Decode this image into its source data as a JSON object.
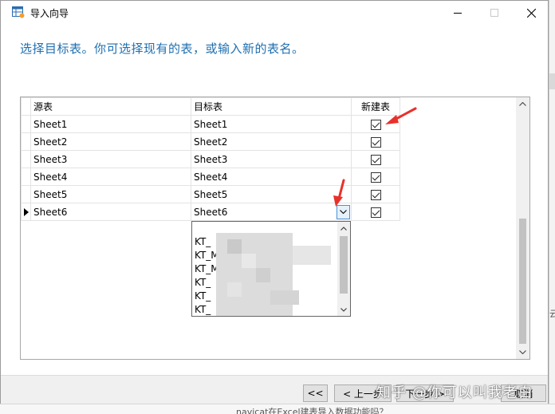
{
  "window": {
    "title": "导入向导",
    "icon": "table-wizard-icon"
  },
  "instruction": "选择目标表。你可选择现有的表，或输入新的表名。",
  "grid": {
    "headers": [
      "源表",
      "目标表",
      "新建表"
    ],
    "rows": [
      {
        "source": "Sheet1",
        "target": "Sheet1",
        "new_table": true
      },
      {
        "source": "Sheet2",
        "target": "Sheet2",
        "new_table": true
      },
      {
        "source": "Sheet3",
        "target": "Sheet3",
        "new_table": true
      },
      {
        "source": "Sheet4",
        "target": "Sheet4",
        "new_table": true
      },
      {
        "source": "Sheet5",
        "target": "Sheet5",
        "new_table": true
      },
      {
        "source": "Sheet6",
        "target": "Sheet6",
        "new_table": true
      }
    ],
    "current_row": 6
  },
  "dropdown": {
    "items": [
      "KT_",
      "KT_M",
      "KT_M",
      "KT_",
      "KT_",
      "KT_"
    ]
  },
  "footer": {
    "first_label": "<<",
    "prev_label": "< 上一步",
    "next_label": "下一步 >",
    "cancel_label": "取消"
  },
  "watermark": "知乎 @你可以叫我老白",
  "background": {
    "bottom_text": "navicat在Excel建表导入数据功能吗？",
    "right_text": "云"
  },
  "colors": {
    "instruction": "#1f6fb0",
    "annotation": "#e8312b",
    "combo_accent": "#4a90d9"
  }
}
